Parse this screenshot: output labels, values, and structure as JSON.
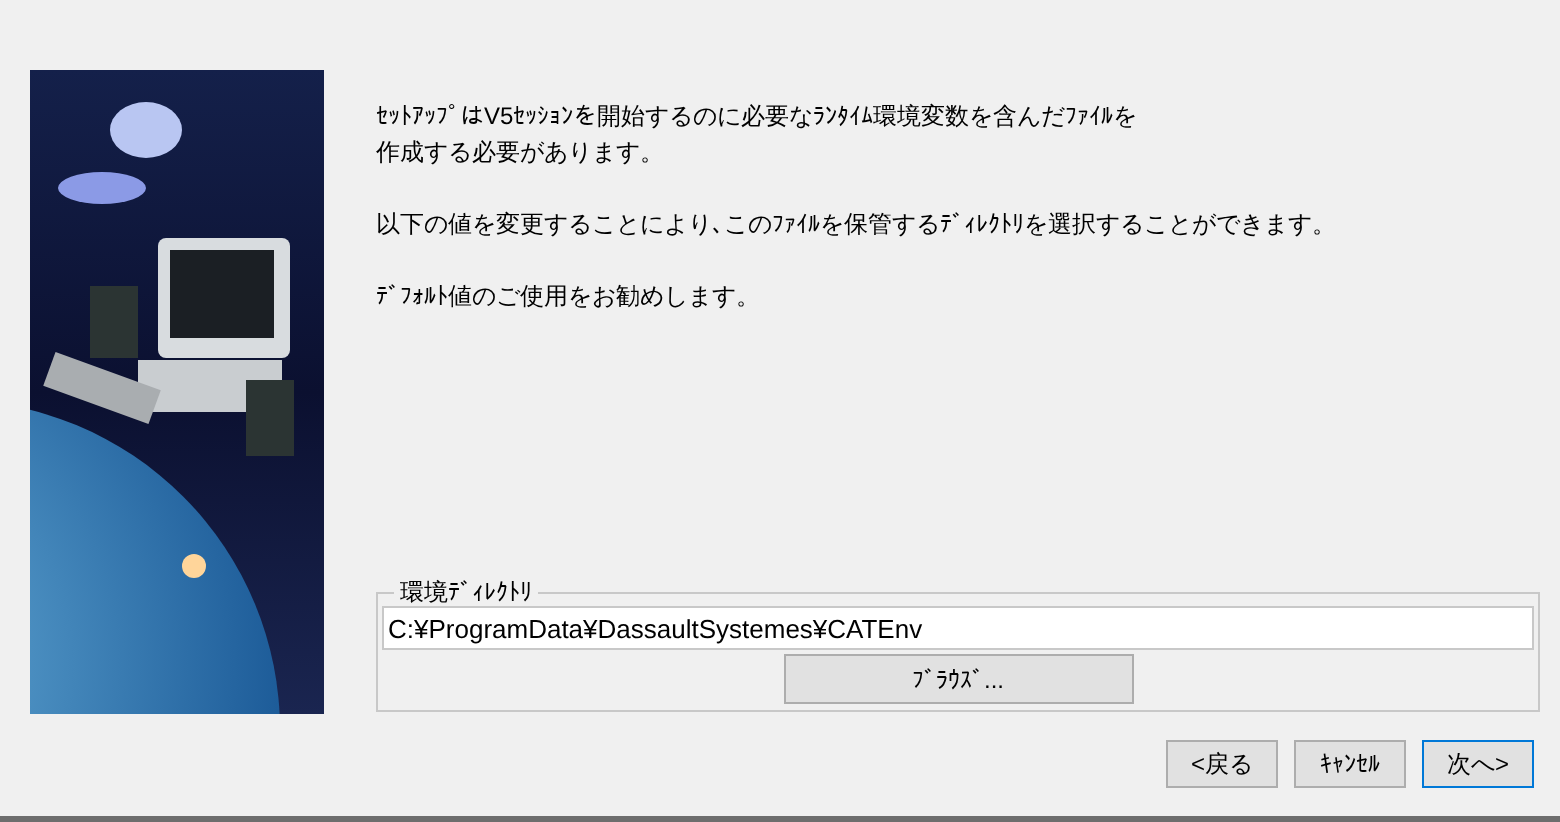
{
  "intro": {
    "lines": [
      "ｾｯﾄｱｯﾌﾟはV5ｾｯｼｮﾝを開始するのに必要なﾗﾝﾀｲﾑ環境変数を含んだﾌｧｲﾙを",
      "作成する必要があります。"
    ]
  },
  "paragraphs": [
    "以下の値を変更することにより､このﾌｧｲﾙを保管するﾃﾞｨﾚｸﾄﾘを選択することができます。",
    "ﾃﾞﾌｫﾙﾄ値のご使用をお勧めします。"
  ],
  "directory_group": {
    "label": "環境ﾃﾞｨﾚｸﾄﾘ",
    "value": "C:¥ProgramData¥DassaultSystemes¥CATEnv",
    "browse_button": "ﾌﾞﾗｳｽﾞ..."
  },
  "buttons": [
    "<戻る",
    "ｷｬﾝｾﾙ",
    "次へ>"
  ]
}
